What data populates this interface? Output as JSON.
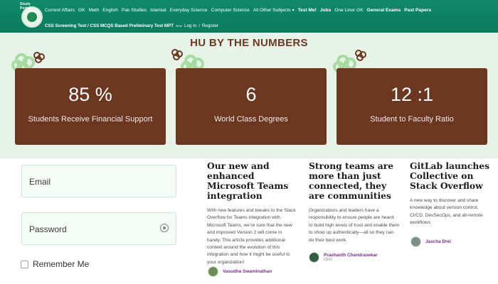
{
  "nav": {
    "logo_text": "Study Portal",
    "primary": [
      "Current Affairs",
      "GK",
      "Math",
      "English",
      "Pak Studies",
      "Islamiat",
      "Everyday Science",
      "Computer Science",
      "All Other Subjects"
    ],
    "caret": "▾",
    "secondary_bold": [
      "Test Me!",
      "Jobs"
    ],
    "one_liner": "One Liner GK",
    "general_exams": "General Exams",
    "past_papers": "Past Papers",
    "row2": [
      "CSS Screening Test / CSS MCQS Based Preliminary Test MPT",
      "Log In",
      "Register"
    ],
    "row2_badge": "New",
    "separator": "/"
  },
  "stats": {
    "title": "HU BY THE NUMBERS",
    "cards": [
      {
        "number": "85 %",
        "label": "Students Receive Financial Support"
      },
      {
        "number": "6",
        "label": "World Class Degrees"
      },
      {
        "number": "12 :1",
        "label": "Student to Faculty Ratio"
      }
    ]
  },
  "login": {
    "email_placeholder": "Email",
    "password_placeholder": "Password",
    "remember_label": "Remember Me"
  },
  "articles": [
    {
      "title": "Our new and enhanced Microsoft Teams integration",
      "body": "With new features and tweaks to the Stack Overflow for Teams integration with Microsoft Teams, we’re sure that the new and improved Version 2 will come in handy. This article provides additional context around the evolution of this integration and how it might be useful to your organization!",
      "author": "Vasudha Swaminathan",
      "role": ""
    },
    {
      "title": "Strong teams are more than just connected, they are communities",
      "body": "Organizations and leaders have a responsibility to ensure people are heard, to build high levels of trust and enable them to show up authentically—all so they can do their best work.",
      "author": "Prashanth Chandrasekar",
      "role": "CEO"
    },
    {
      "title": "GitLab launches Collective on Stack Overflow",
      "body": "A new way to discover and share knowledge about version control, CI/CD, DevSecOps, and all-remote workflows",
      "author": "Jascha Drel",
      "role": ""
    }
  ],
  "colors": {
    "nav_green": "#0b7a5c",
    "card_brown": "#6b3720",
    "section_bg": "#e7f3e9",
    "flower_green": "#a7dca0",
    "flower_brown": "#6b3720",
    "author_purple": "#7a2b8a"
  }
}
